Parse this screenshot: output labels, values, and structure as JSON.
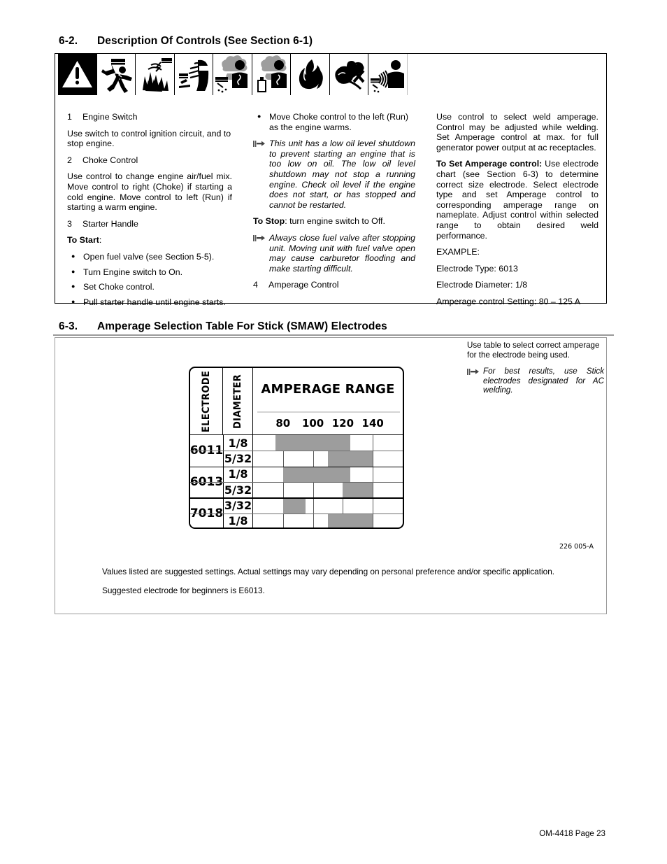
{
  "page": {
    "footer": "OM-4418 Page 23"
  },
  "section_62": {
    "number": "6-2.",
    "title": "Description Of Controls (See Section 6-1)",
    "safety_icons": [
      "warning-triangle-icon",
      "electric-shock-icon",
      "arc-spark-explosion-icon",
      "welding-helmet-arc-rays-icon",
      "welding-fumes-icon",
      "welding-fumes-cylinder-icon",
      "fire-flame-icon",
      "moving-parts-hand-icon",
      "emf-noise-waves-icon"
    ],
    "col1": {
      "item1_num": "1",
      "item1_label": "Engine Switch",
      "item1_body": "Use switch to control ignition circuit, and to stop engine.",
      "item2_num": "2",
      "item2_label": "Choke Control",
      "item2_body": "Use control to change engine air/fuel mix. Move control to right (Choke) if starting a cold engine. Move control to left (Run) if starting a warm engine.",
      "item3_num": "3",
      "item3_label": "Starter Handle",
      "to_start_label": "To Start",
      "to_start_colon": ":",
      "bullets": [
        "Open fuel valve (see Section 5-5).",
        "Turn Engine switch to On.",
        "Set Choke control.",
        "Pull starter handle until engine starts."
      ]
    },
    "col2": {
      "bullets": [
        "Move Choke control to the left (Run) as the engine warms."
      ],
      "note1": "This unit has a low oil level shutdown to prevent starting an engine that is too low on oil.  The low oil level shutdown may not stop a running engine. Check oil level if the engine does not start, or has stopped and cannot be restarted.",
      "to_stop_label": "To Stop",
      "to_stop_body": ": turn engine switch to Off.",
      "note2": "Always close fuel valve after stopping unit. Moving unit with fuel valve open may cause carburetor flooding and make starting difficult.",
      "item4_num": "4",
      "item4_label": "Amperage Control"
    },
    "col3": {
      "para1": "Use control to select weld amperage. Control may be adjusted while welding. Set Amperage control at max. for full generator power output at ac receptacles.",
      "set_label": "To Set Amperage control:",
      "set_body": " Use electrode chart (see Section 6-3) to determine correct size electrode. Select electrode type and set Amperage control to corresponding amperage range on nameplate. Adjust control within selected range to obtain desired weld performance.",
      "example_label": "EXAMPLE:",
      "example_type": "Electrode Type: 6013",
      "example_diameter": "Electrode Diameter: 1/8",
      "example_setting": "Amperage control Setting: 80 – 125 A"
    }
  },
  "section_63": {
    "number": "6-3.",
    "title": "Amperage Selection Table For Stick (SMAW) Electrodes",
    "side_note_intro": "Use table  to select correct amperage for the electrode being used.",
    "side_note": "For best results, use   Stick electrodes designated for AC welding.",
    "figure_number": "226 005-A",
    "footnote1": "Values listed are suggested settings. Actual settings may vary depending on personal preference and/or specific application.",
    "footnote2": "Suggested electrode for beginners is E6013."
  },
  "chart_data": {
    "type": "table",
    "title": "AMPERAGE RANGE",
    "col_headers": [
      "ELECTRODE",
      "DIAMETER",
      "AMPERAGE RANGE"
    ],
    "tick_labels": [
      "80",
      "100",
      "120",
      "140"
    ],
    "tick_values": [
      80,
      100,
      120,
      140
    ],
    "xlim": [
      60,
      160
    ],
    "bar_color": "#9d9d9d",
    "rows": [
      {
        "electrode": "6011",
        "diameter": "1/8",
        "amp_min": 75,
        "amp_max": 125
      },
      {
        "electrode": "6011",
        "diameter": "5/32",
        "amp_min": 110,
        "amp_max": 140
      },
      {
        "electrode": "6013",
        "diameter": "1/8",
        "amp_min": 80,
        "amp_max": 125
      },
      {
        "electrode": "6013",
        "diameter": "5/32",
        "amp_min": 120,
        "amp_max": 140
      },
      {
        "electrode": "7018",
        "diameter": "3/32",
        "amp_min": 80,
        "amp_max": 95
      },
      {
        "electrode": "7018",
        "diameter": "1/8",
        "amp_min": 110,
        "amp_max": 140
      }
    ],
    "groups": [
      {
        "electrode": "6011",
        "diameters": [
          "1/8",
          "5/32"
        ]
      },
      {
        "electrode": "6013",
        "diameters": [
          "1/8",
          "5/32"
        ]
      },
      {
        "electrode": "7018",
        "diameters": [
          "3/32",
          "1/8"
        ]
      }
    ]
  }
}
